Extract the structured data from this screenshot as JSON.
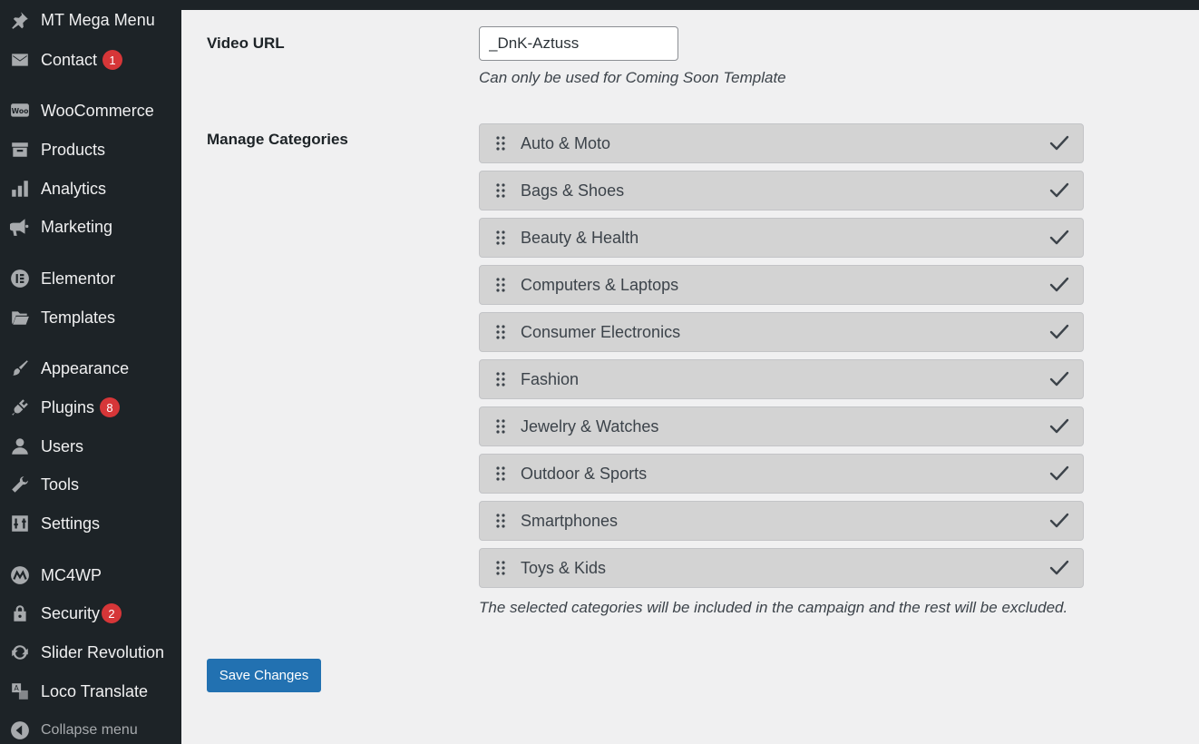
{
  "sidebar": {
    "items": [
      {
        "label": "MT Mega Menu",
        "icon": "pin-icon"
      },
      {
        "label": "Contact",
        "icon": "mail-icon",
        "badge": "1"
      },
      {
        "label": "WooCommerce",
        "icon": "woocommerce-icon"
      },
      {
        "label": "Products",
        "icon": "archive-icon"
      },
      {
        "label": "Analytics",
        "icon": "bar-chart-icon"
      },
      {
        "label": "Marketing",
        "icon": "megaphone-icon"
      },
      {
        "label": "Elementor",
        "icon": "elementor-icon"
      },
      {
        "label": "Templates",
        "icon": "folder-icon"
      },
      {
        "label": "Appearance",
        "icon": "paintbrush-icon"
      },
      {
        "label": "Plugins",
        "icon": "plug-icon",
        "badge": "8"
      },
      {
        "label": "Users",
        "icon": "user-icon"
      },
      {
        "label": "Tools",
        "icon": "wrench-icon"
      },
      {
        "label": "Settings",
        "icon": "sliders-icon"
      },
      {
        "label": "MC4WP",
        "icon": "mc4wp-icon"
      },
      {
        "label": "Security",
        "icon": "lock-icon",
        "badge": "2"
      },
      {
        "label": "Slider Revolution",
        "icon": "refresh-icon"
      },
      {
        "label": "Loco Translate",
        "icon": "translate-icon"
      }
    ],
    "collapse_label": "Collapse menu"
  },
  "form": {
    "video_url": {
      "label": "Video URL",
      "value": "_DnK-Aztuss",
      "description": "Can only be used for Coming Soon Template"
    },
    "categories": {
      "label": "Manage Categories",
      "items": [
        {
          "name": "Auto & Moto",
          "checked": true
        },
        {
          "name": "Bags & Shoes",
          "checked": true
        },
        {
          "name": "Beauty & Health",
          "checked": true
        },
        {
          "name": "Computers & Laptops",
          "checked": true
        },
        {
          "name": "Consumer Electronics",
          "checked": true
        },
        {
          "name": "Fashion",
          "checked": true
        },
        {
          "name": "Jewelry & Watches",
          "checked": true
        },
        {
          "name": "Outdoor & Sports",
          "checked": true
        },
        {
          "name": "Smartphones",
          "checked": true
        },
        {
          "name": "Toys & Kids",
          "checked": true
        }
      ],
      "description": "The selected categories will be included in the campaign and the rest will be excluded."
    },
    "save_label": "Save Changes"
  },
  "colors": {
    "sidebar_bg": "#1d2327",
    "content_bg": "#f0f0f1",
    "badge": "#d63638",
    "primary_button": "#2271b1",
    "category_bg": "#d3d3d3"
  }
}
